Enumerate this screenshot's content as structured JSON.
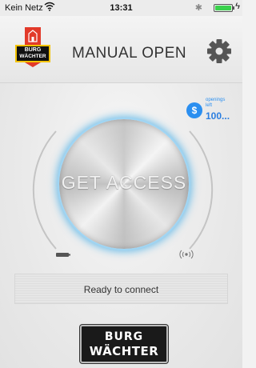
{
  "status_bar": {
    "carrier": "Kein Netz",
    "time": "13:31"
  },
  "header": {
    "title": "MANUAL OPEN",
    "logo_text_1": "BURG",
    "logo_text_2": "WÄCHTER"
  },
  "openings": {
    "label": "openings left",
    "value": "100..."
  },
  "dial": {
    "button_label": "GET ACCESS"
  },
  "status": {
    "text": "Ready to connect"
  },
  "footer_logo": {
    "line1": "BURG",
    "line2": "WÄCHTER"
  },
  "colors": {
    "accent": "#2b8ff0",
    "glow": "#3aaae6"
  },
  "icons": [
    "wifi-icon",
    "bluetooth-icon",
    "battery-icon",
    "gear-icon",
    "dollar-icon",
    "battery-low-icon",
    "signal-icon"
  ]
}
